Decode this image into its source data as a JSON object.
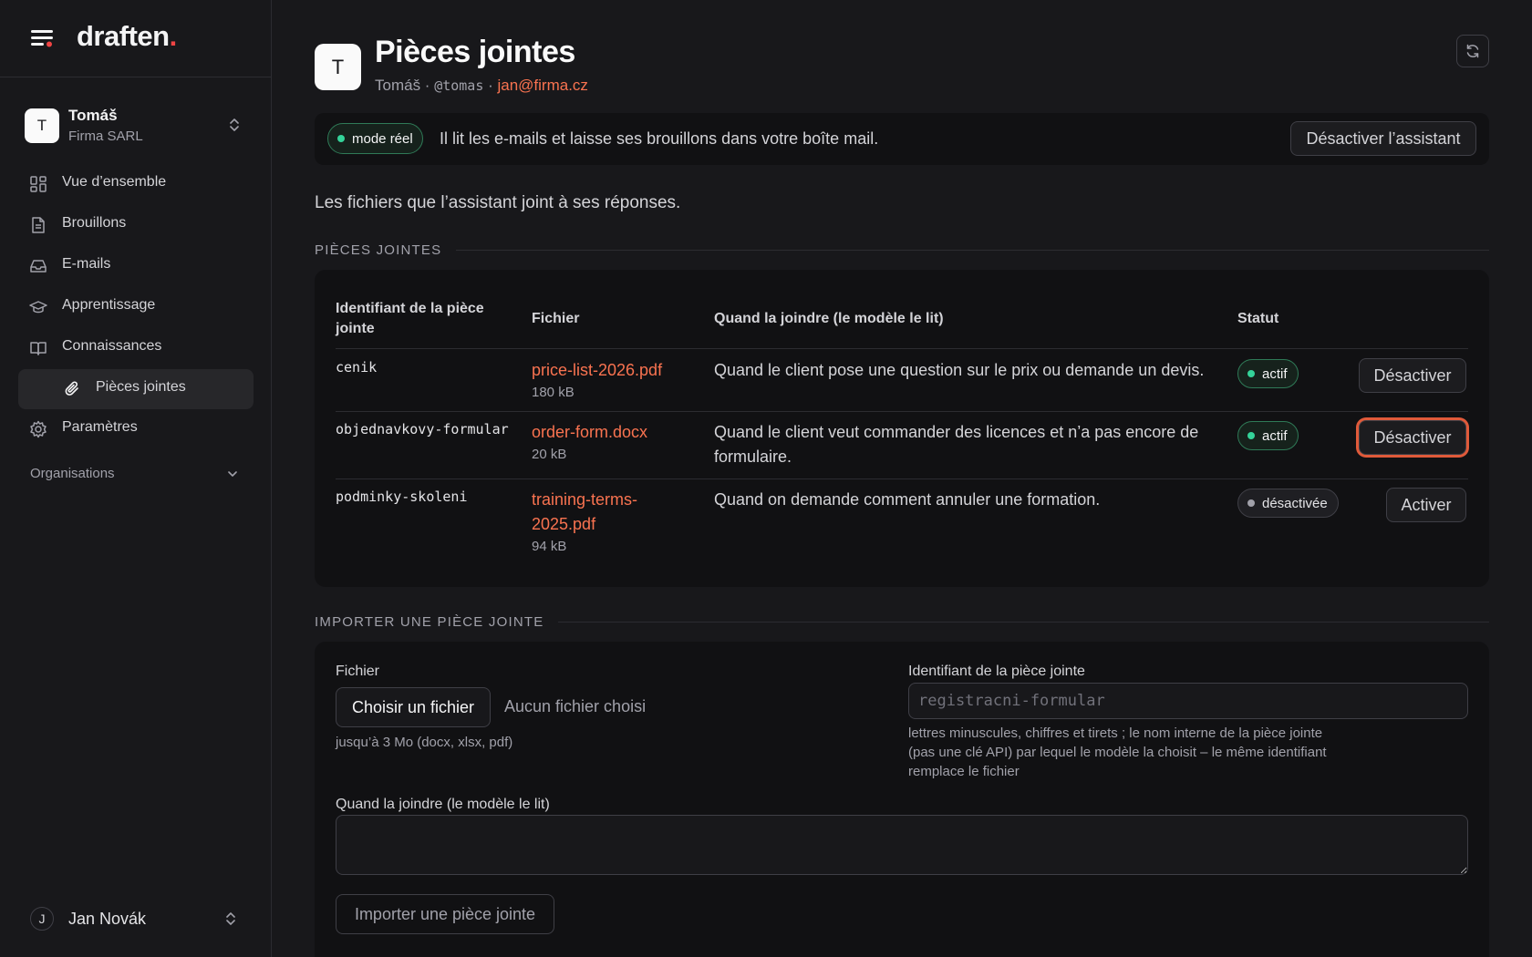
{
  "app": {
    "brand": "draften",
    "brand_dot": "."
  },
  "workspace": {
    "initial": "T",
    "name": "Tomáš",
    "subtitle": "Firma SARL"
  },
  "sidebar": {
    "items": [
      {
        "label": "Vue d’ensemble",
        "icon": "dashboard-icon"
      },
      {
        "label": "Brouillons",
        "icon": "document-icon"
      },
      {
        "label": "E-mails",
        "icon": "inbox-icon"
      },
      {
        "label": "Apprentissage",
        "icon": "graduation-cap-icon"
      },
      {
        "label": "Connaissances",
        "icon": "book-icon"
      }
    ],
    "sub_item": {
      "label": "Pièces jointes",
      "icon": "paperclip-icon"
    },
    "settings": {
      "label": "Paramètres",
      "icon": "gear-icon"
    },
    "organisations": "Organisations"
  },
  "user": {
    "initial": "J",
    "name": "Jan Novák"
  },
  "page": {
    "initial": "T",
    "title": "Pièces jointes",
    "meta_name": "Tomáš",
    "meta_sep": " · ",
    "meta_handle": "@tomas",
    "meta_email": "jan@firma.cz"
  },
  "banner": {
    "mode": "mode réel",
    "text": "Il lit les e-mails et laisse ses brouillons dans votre boîte mail.",
    "disable_button": "Désactiver l’assistant"
  },
  "description": "Les fichiers que l’assistant joint à ses réponses.",
  "attachments": {
    "section_title": "PIÈCES JOINTES",
    "headers": {
      "id_line1": "Identifiant de la pièce",
      "id_line2": "jointe",
      "file": "Fichier",
      "when": "Quand la joindre (le modèle le lit)",
      "status": "Statut"
    },
    "rows": [
      {
        "id": "cenik",
        "file": "price-list-2026.pdf",
        "size": "180 kB",
        "when": "Quand le client pose une question sur le prix ou demande un devis.",
        "status": "actif",
        "status_kind": "active",
        "action": "Désactiver"
      },
      {
        "id": "objednavkovy-formular",
        "file": "order-form.docx",
        "size": "20 kB",
        "when_line1": "Quand le client veut commander des licences et n’a pas encore de",
        "when_line2": "formulaire.",
        "status": "actif",
        "status_kind": "active",
        "action": "Désactiver"
      },
      {
        "id": "podminky-skoleni",
        "file_line1": "training-terms-",
        "file_line2": "2025.pdf",
        "size": "94 kB",
        "when": "Quand on demande comment annuler une formation.",
        "status": "désactivée",
        "status_kind": "inactive",
        "action": "Activer"
      }
    ]
  },
  "import": {
    "section_title": "IMPORTER UNE PIÈCE JOINTE",
    "file_label": "Fichier",
    "choose_button": "Choisir un fichier",
    "no_file": "Aucun fichier choisi",
    "file_hint": "jusqu’à 3 Mo (docx, xlsx, pdf)",
    "id_label": "Identifiant de la pièce jointe",
    "id_placeholder": "registracni-formular",
    "id_hint_line1": "lettres minuscules, chiffres et tirets ; le nom interne de la pièce jointe",
    "id_hint_line2": "(pas une clé API) par lequel le modèle la choisit – le même identifiant",
    "id_hint_line3": "remplace le fichier",
    "when_label": "Quand la joindre (le modèle le lit)",
    "when_value": "",
    "submit_button": "Importer une pièce jointe"
  },
  "colors": {
    "accent": "#f97350",
    "active_dot": "#34d399",
    "focus_ring": "#e05a3a",
    "background": "#18181b"
  }
}
